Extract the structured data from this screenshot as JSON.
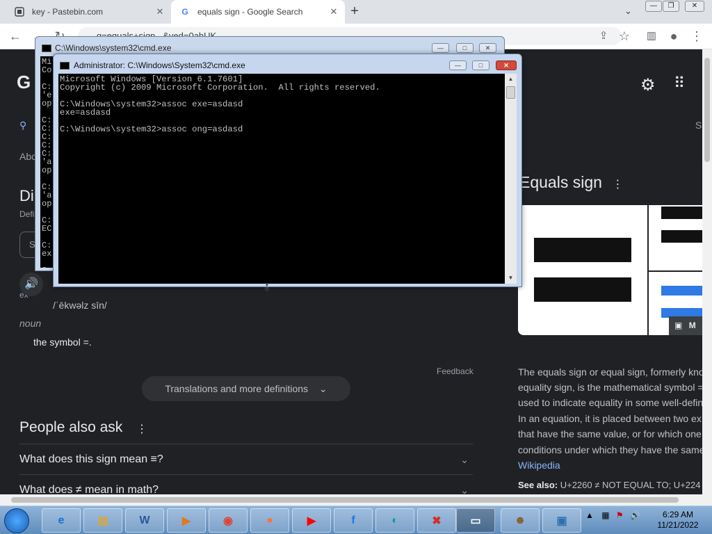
{
  "browser": {
    "tabs": [
      {
        "title": "key - Pastebin.com",
        "favicon": "pastebin-icon"
      },
      {
        "title": "equals sign - Google Search",
        "favicon": "google-icon"
      }
    ],
    "new_tab": "+",
    "url": "...q=equals+sign...&ved=0ahUK..."
  },
  "serp": {
    "logo_letter": "G",
    "abo": "Abo",
    "dic": "Di",
    "defi": "Defi",
    "s_box": "S",
    "ex": "ex",
    "s_right": "S",
    "phonetic": "/ˈēkwəlz sīn/",
    "noun": "noun",
    "definition": "the symbol =.",
    "feedback": "Feedback",
    "translations": "Translations and more definitions",
    "people_also_ask": "People also ask",
    "questions": [
      "What does this sign mean ≡?",
      "What does ≠ mean in math?"
    ]
  },
  "knowledge_panel": {
    "title": "Equals sign",
    "image_more": "M",
    "description_lines": [
      "The equals sign or equal sign, formerly kno",
      "equality sign, is the mathematical symbol =",
      "used to indicate equality in some well-defin",
      "In an equation, it is placed between two ex",
      "that have the same value, or for which one",
      "conditions under which they have the same"
    ],
    "source": "Wikipedia",
    "see_also_label": "See also:",
    "see_also_text": "U+2260 ≠ NOT EQUAL TO; U+224"
  },
  "cmd_back": {
    "title": "C:\\Windows\\system32\\cmd.exe",
    "lines": "Mi\nCo\n\nC:\n'e\nop\n\nC:\nC:\nC:\nC:\nC:\n'a\nop\n\nC:\n'a\nop\n\nC:\nEC\n\nC:\nex\n\nC:"
  },
  "cmd_front": {
    "title": "Administrator: C:\\Windows\\System32\\cmd.exe",
    "lines": [
      "Microsoft Windows [Version 6.1.7601]",
      "Copyright (c) 2009 Microsoft Corporation.  All rights reserved.",
      "",
      "C:\\Windows\\system32>assoc exe=asdasd",
      "exe=asdasd",
      "",
      "C:\\Windows\\system32>assoc ong=asdasd"
    ]
  },
  "taskbar": {
    "clock_time": "6:29 AM",
    "clock_date": "11/21/2022",
    "items": [
      "ie-icon",
      "explorer-icon",
      "word-icon",
      "media-player-icon",
      "chrome-icon",
      "firefox-icon",
      "youtube-icon",
      "facebook-icon",
      "edge-icon",
      "stop-icon",
      "cmd-icon",
      "user-app-icon",
      "photo-viewer-icon"
    ]
  },
  "colors": {
    "page_bg": "#202124",
    "link": "#8ab4f8",
    "cmd_bg": "#000000",
    "cmd_text": "#c0c0c0"
  }
}
